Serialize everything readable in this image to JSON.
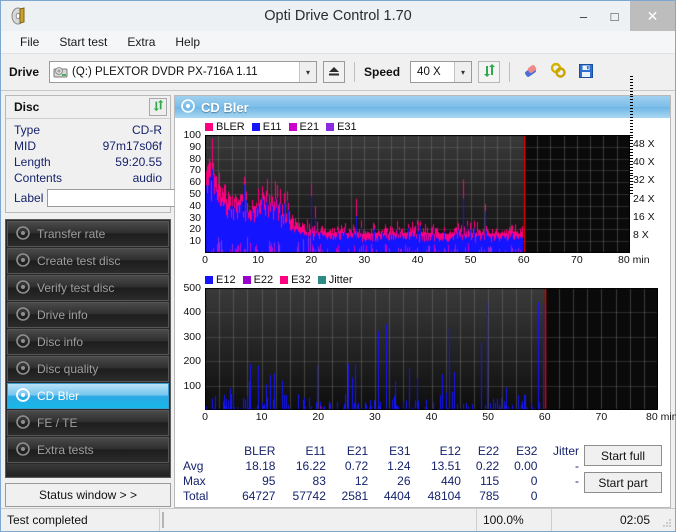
{
  "window": {
    "title": "Opti Drive Control 1.70",
    "app_icon": "disc-icon",
    "minimize": "–",
    "maximize": "□",
    "close": "✕"
  },
  "menu": {
    "items": [
      {
        "label": "File"
      },
      {
        "label": "Start test"
      },
      {
        "label": "Extra"
      },
      {
        "label": "Help"
      }
    ]
  },
  "toolbar": {
    "drive_label": "Drive",
    "drive_value": "(Q:)   PLEXTOR DVDR   PX-716A 1.11",
    "drive_arrow": "▾",
    "eject_icon": "eject-icon",
    "speed_label": "Speed",
    "speed_value": "40 X",
    "speed_arrow": "▾",
    "refresh_icon": "refresh-icon",
    "eraser_icon": "eraser-icon",
    "plug_icon": "plug-icon",
    "save_icon": "save-icon"
  },
  "disc": {
    "heading": "Disc",
    "refresh_icon": "refresh-icon",
    "rows": [
      {
        "key": "Type",
        "value": "CD-R"
      },
      {
        "key": "MID",
        "value": "97m17s06f"
      },
      {
        "key": "Length",
        "value": "59:20.55"
      },
      {
        "key": "Contents",
        "value": "audio"
      }
    ],
    "label_key": "Label",
    "label_value": "",
    "label_placeholder": "",
    "label_icon": "cd-icon"
  },
  "nav": {
    "items": [
      {
        "label": "Transfer rate",
        "icon": "disc-icon",
        "active": false
      },
      {
        "label": "Create test disc",
        "icon": "disc-icon",
        "active": false
      },
      {
        "label": "Verify test disc",
        "icon": "disc-icon",
        "active": false
      },
      {
        "label": "Drive info",
        "icon": "disc-icon",
        "active": false
      },
      {
        "label": "Disc info",
        "icon": "disc-icon",
        "active": false
      },
      {
        "label": "Disc quality",
        "icon": "disc-icon",
        "active": false
      },
      {
        "label": "CD Bler",
        "icon": "disc-icon",
        "active": true
      },
      {
        "label": "FE / TE",
        "icon": "disc-icon",
        "active": false
      },
      {
        "label": "Extra tests",
        "icon": "disc-icon",
        "active": false
      }
    ],
    "status_window": "Status window > >"
  },
  "panel": {
    "title": "CD Bler",
    "icon": "disc-icon"
  },
  "chart_data": [
    {
      "type": "area",
      "title": "CD Bler errors",
      "xlabel": "min",
      "ylabel": "",
      "xlim": [
        0,
        80
      ],
      "ylim": [
        0,
        100
      ],
      "xticks": [
        0,
        10,
        20,
        30,
        40,
        50,
        60,
        70,
        80
      ],
      "xticklabels": [
        "0",
        "10",
        "20",
        "30",
        "40",
        "50",
        "60",
        "70",
        "80 min"
      ],
      "yticks": [
        10,
        20,
        30,
        40,
        50,
        60,
        70,
        80,
        90,
        100
      ],
      "right_axis": {
        "label": "speed",
        "ticks": [
          8,
          16,
          24,
          32,
          40,
          48
        ],
        "ticklabels": [
          "8 X",
          "16 X",
          "24 X",
          "32 X",
          "40 X",
          "48 X"
        ],
        "lim": [
          0,
          52
        ]
      },
      "grid": true,
      "legend_position": "top-left",
      "data_end_x": 60,
      "marker_line_x": 60,
      "marker_line_color": "#ee0000",
      "background": "#161616",
      "series": [
        {
          "name": "BLER",
          "color": "#ff0080",
          "avg": 18.18,
          "max": 95,
          "total": 64727
        },
        {
          "name": "E11",
          "color": "#1414ff",
          "avg": 16.22,
          "max": 83,
          "total": 57742
        },
        {
          "name": "E21",
          "color": "#cc00cc",
          "avg": 0.72,
          "max": 12,
          "total": 2581
        },
        {
          "name": "E31",
          "color": "#8a2be2",
          "avg": 1.24,
          "max": 26,
          "total": 4404
        }
      ]
    },
    {
      "type": "area",
      "title": "CD Bler E12 / E22 / E32 / Jitter",
      "xlabel": "min",
      "ylabel": "",
      "xlim": [
        0,
        80
      ],
      "ylim": [
        0,
        500
      ],
      "xticks": [
        0,
        10,
        20,
        30,
        40,
        50,
        60,
        70,
        80
      ],
      "xticklabels": [
        "0",
        "10",
        "20",
        "30",
        "40",
        "50",
        "60",
        "70",
        "80 min"
      ],
      "yticks": [
        100,
        200,
        300,
        400,
        500
      ],
      "grid": true,
      "legend_position": "top-left",
      "data_end_x": 60,
      "marker_line_x": 60,
      "marker_line_color": "#ee0000",
      "background": "#161616",
      "series": [
        {
          "name": "E12",
          "color": "#1414ff",
          "avg": 13.51,
          "max": 440,
          "total": 48104
        },
        {
          "name": "E22",
          "color": "#9900cc",
          "avg": 0.22,
          "max": 115,
          "total": 785
        },
        {
          "name": "E32",
          "color": "#ff0080",
          "avg": 0.0,
          "max": 0,
          "total": 0
        },
        {
          "name": "Jitter",
          "color": "#2e8b84",
          "avg": "-",
          "max": "-",
          "total": ""
        }
      ]
    }
  ],
  "stats": {
    "columns": [
      "BLER",
      "E11",
      "E21",
      "E31",
      "E12",
      "E22",
      "E32",
      "Jitter"
    ],
    "rows": [
      {
        "label": "Avg",
        "values": [
          "18.18",
          "16.22",
          "0.72",
          "1.24",
          "13.51",
          "0.22",
          "0.00",
          "-"
        ]
      },
      {
        "label": "Max",
        "values": [
          "95",
          "83",
          "12",
          "26",
          "440",
          "115",
          "0",
          "-"
        ]
      },
      {
        "label": "Total",
        "values": [
          "64727",
          "57742",
          "2581",
          "4404",
          "48104",
          "785",
          "0",
          ""
        ]
      }
    ]
  },
  "actions": {
    "start_full": "Start full",
    "start_part": "Start part"
  },
  "statusbar": {
    "message": "Test completed",
    "percent_label": "100.0%",
    "percent_value": 100,
    "time": "02:05",
    "progress_color": "#17a317"
  }
}
